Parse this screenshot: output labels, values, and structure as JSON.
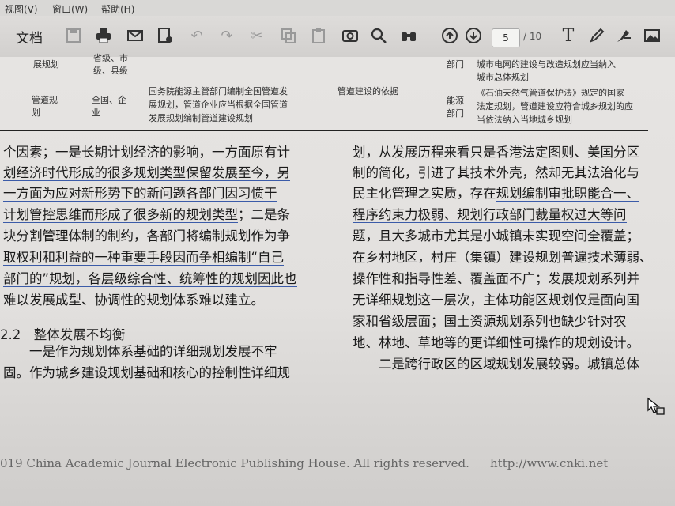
{
  "menu": {
    "view": "视图(V)",
    "window": "窗口(W)",
    "help": "帮助(H)"
  },
  "toolbar": {
    "doc_label": "文档",
    "page_current": "5",
    "page_total": "/ 10",
    "icons": [
      "save-icon",
      "print-icon",
      "email-icon",
      "annotate-icon",
      "undo-icon",
      "redo-icon",
      "cut-icon",
      "copy-icon",
      "paste-icon",
      "snapshot-icon",
      "search-icon",
      "binoculars-icon",
      "page-up-icon",
      "page-down-icon",
      "text-icon",
      "pen-icon",
      "highlighter-icon",
      "image-icon"
    ]
  },
  "table": {
    "row0": {
      "c1": "展规划",
      "c2a": "省级、市",
      "c2b": "级、县级",
      "c4": "部门",
      "c5a": "城市电网的建设与改造规划应当纳入",
      "c5b": "城市总体规划"
    },
    "row1": {
      "c1a": "管道规",
      "c1b": "划",
      "c2a": "全国、企",
      "c2b": "业",
      "c3a": "国务院能源主管部门编制全国管道发",
      "c3b": "展规划，管道企业应当根据全国管道",
      "c3c": "发展规划编制管道建设规划",
      "c3d": "管道建设的依据",
      "c4a": "能源",
      "c4b": "部门",
      "c5a": "《石油天然气管道保护法》规定的国家",
      "c5b": "法定规划，管道建设应符合城乡规划的应",
      "c5c": "当依法纳入当地城乡规划"
    }
  },
  "left_col": {
    "l1a": "个因素",
    "l1b": "；一是长期计划经济的影响，一方面原有计",
    "l2": "划经济时代形成的很多规划类型保留发展至今，另",
    "l3": "一方面为应对新形势下的新问题各部门因习惯干",
    "l4a": "计划管控思维而形成了很多新的规划类型",
    "l4b": "；二是条",
    "l5": "块分割管理体制的制约，各部门将编制规划作为争",
    "l6": "取权利和利益的一种重要手段因而争相编制“自己",
    "l7": "部门的”规划，各层级综合性、统筹性的规划因此也",
    "l8": "难以发展成型、协调性的规划体系难以建立。",
    "heading": "2.2　整体发展不均衡",
    "l9": "　　一是作为规划体系基础的详细规划发展不牢",
    "l10": "固。作为城乡建设规划基础和核心的控制性详细规"
  },
  "right_col": {
    "r1": "划，从发展历程来看只是香港法定图则、美国分区",
    "r2": "制的简化，引进了其技术外壳，然却无其法治化与",
    "r3a": "民主化管理之实质，存在",
    "r3b": "规划编制审批职能合一、",
    "r4": "程序约束力极弱、规划行政部门裁量权过大等问",
    "r5a": "题，且大多城市尤其是小城镇未实现空间全覆盖",
    "r5b": "；",
    "r6": "在乡村地区，村庄（集镇）建设规划普遍技术薄弱、",
    "r7": "操作性和指导性差、覆盖面不广；发展规划系列并",
    "r8": "无详细规划这一层次，主体功能区规划仅是面向国",
    "r9": "家和省级层面；国土资源规划系列也缺少针对农",
    "r10": "地、林地、草地等的更详细性可操作的规划设计。",
    "r11": "　　二是跨行政区的区域规划发展较弱。城镇总体"
  },
  "footer": {
    "copyright": "019 China Academic Journal Electronic Publishing House. All rights reserved.",
    "url": "http://www.cnki.net"
  }
}
